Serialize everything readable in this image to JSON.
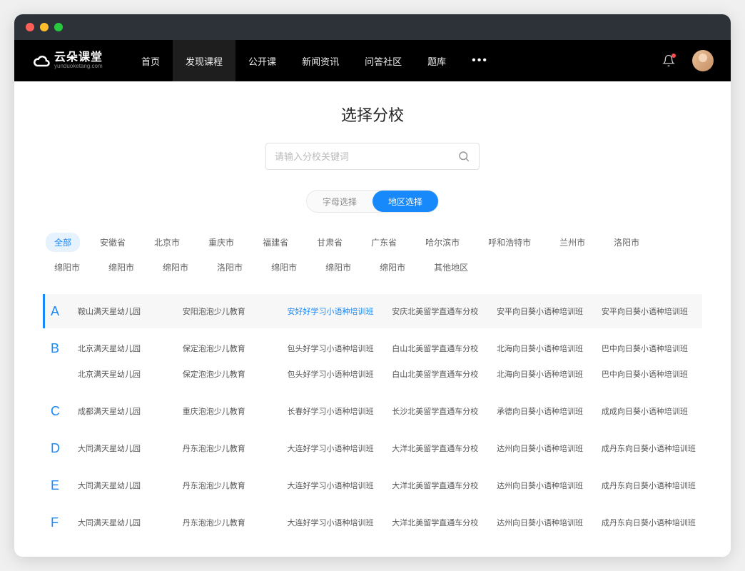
{
  "logo": {
    "text": "云朵课堂",
    "sub": "yunduoketang.com"
  },
  "nav": {
    "items": [
      "首页",
      "发现课程",
      "公开课",
      "新闻资讯",
      "问答社区",
      "题库"
    ],
    "active_index": 1
  },
  "page": {
    "title": "选择分校",
    "search_placeholder": "请输入分校关键词",
    "toggle": {
      "alpha": "字母选择",
      "region": "地区选择",
      "active": "region"
    },
    "regions": [
      "全部",
      "安徽省",
      "北京市",
      "重庆市",
      "福建省",
      "甘肃省",
      "广东省",
      "哈尔滨市",
      "呼和浩特市",
      "兰州市",
      "洛阳市",
      "绵阳市",
      "绵阳市",
      "绵阳市",
      "洛阳市",
      "绵阳市",
      "绵阳市",
      "绵阳市",
      "其他地区"
    ],
    "region_active": 0,
    "sections": [
      {
        "letter": "A",
        "highlighted": true,
        "rows": [
          [
            {
              "t": "鞍山满天星幼儿园"
            },
            {
              "t": "安阳泡泡少儿教育"
            },
            {
              "t": "安好好学习小语种培训班",
              "hl": true
            },
            {
              "t": "安庆北美留学直通车分校"
            },
            {
              "t": "安平向日葵小语种培训班"
            },
            {
              "t": "安平向日葵小语种培训班"
            }
          ]
        ]
      },
      {
        "letter": "B",
        "rows": [
          [
            {
              "t": "北京满天星幼儿园"
            },
            {
              "t": "保定泡泡少儿教育"
            },
            {
              "t": "包头好学习小语种培训班"
            },
            {
              "t": "白山北美留学直通车分校"
            },
            {
              "t": "北海向日葵小语种培训班"
            },
            {
              "t": "巴中向日葵小语种培训班"
            }
          ],
          [
            {
              "t": "北京满天星幼儿园"
            },
            {
              "t": "保定泡泡少儿教育"
            },
            {
              "t": "包头好学习小语种培训班"
            },
            {
              "t": "白山北美留学直通车分校"
            },
            {
              "t": "北海向日葵小语种培训班"
            },
            {
              "t": "巴中向日葵小语种培训班"
            }
          ]
        ]
      },
      {
        "letter": "C",
        "rows": [
          [
            {
              "t": "成都满天星幼儿园"
            },
            {
              "t": "重庆泡泡少儿教育"
            },
            {
              "t": "长春好学习小语种培训班"
            },
            {
              "t": "长沙北美留学直通车分校"
            },
            {
              "t": "承德向日葵小语种培训班"
            },
            {
              "t": "成成向日葵小语种培训班"
            }
          ]
        ]
      },
      {
        "letter": "D",
        "rows": [
          [
            {
              "t": "大同满天星幼儿园"
            },
            {
              "t": "丹东泡泡少儿教育"
            },
            {
              "t": "大连好学习小语种培训班"
            },
            {
              "t": "大洋北美留学直通车分校"
            },
            {
              "t": "达州向日葵小语种培训班"
            },
            {
              "t": "成丹东向日葵小语种培训班"
            }
          ]
        ]
      },
      {
        "letter": "E",
        "rows": [
          [
            {
              "t": "大同满天星幼儿园"
            },
            {
              "t": "丹东泡泡少儿教育"
            },
            {
              "t": "大连好学习小语种培训班"
            },
            {
              "t": "大洋北美留学直通车分校"
            },
            {
              "t": "达州向日葵小语种培训班"
            },
            {
              "t": "成丹东向日葵小语种培训班"
            }
          ]
        ]
      },
      {
        "letter": "F",
        "rows": [
          [
            {
              "t": "大同满天星幼儿园"
            },
            {
              "t": "丹东泡泡少儿教育"
            },
            {
              "t": "大连好学习小语种培训班"
            },
            {
              "t": "大洋北美留学直通车分校"
            },
            {
              "t": "达州向日葵小语种培训班"
            },
            {
              "t": "成丹东向日葵小语种培训班"
            }
          ]
        ]
      }
    ]
  }
}
